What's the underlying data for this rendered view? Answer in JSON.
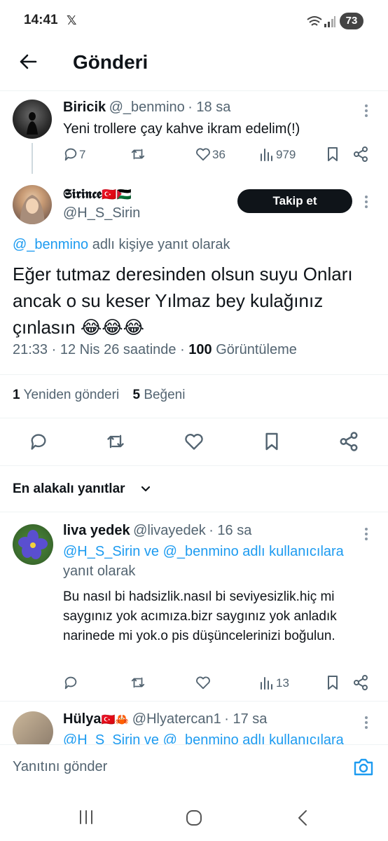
{
  "status_bar": {
    "time": "14:41",
    "app_glyph": "𝕏",
    "battery": "73"
  },
  "header": {
    "title": "Gönderi",
    "back_icon": "back-arrow-icon"
  },
  "parent_post": {
    "name": "Biricik",
    "handle": "@_benmino",
    "time": "· 18 sa",
    "text": "Yeni trollere çay kahve ikram edelim(!)",
    "replies": "7",
    "likes": "36",
    "views": "979"
  },
  "main_post": {
    "name": "𝕾𝖎𝖗𝖎𝖓𝖈𝖊",
    "name_flags": "🇹🇷🇵🇸",
    "handle": "@H_S_Sirin",
    "follow_label": "Takip et",
    "reply_to_handle": "@_benmino",
    "reply_to_suffix": " adlı kişiye yanıt olarak",
    "text": "Eğer tutmaz deresinden olsun suyu Onları ancak o su keser Yılmaz bey kulağınız çınlasın 😂😂😂",
    "time": "21:33",
    "date": "· 12 Nis 26 saatinde ·",
    "views_count": "100",
    "views_label": "Görüntüleme",
    "reposts_count": "1",
    "reposts_label": "Yeniden gönderi",
    "likes_count": "5",
    "likes_label": "Beğeni"
  },
  "replies_section": {
    "sort_label": "En alakalı yanıtlar"
  },
  "replies": [
    {
      "name": "liva yedek",
      "handle": "@livayedek",
      "time": "· 16 sa",
      "reply_to": "@H_S_Sirin ve @_benmino adlı kullanıcılara",
      "reply_suffix": "yanıt olarak",
      "text": "Bu nasıl bi hadsizlik.nasıl bi seviyesizlik.hiç mi saygınız yok acımıza.bizr saygınız yok anladık narinede mi yok.o pis düşüncelerinizi boğulun.",
      "views": "13"
    },
    {
      "name": "Hülya",
      "name_flags": "🇹🇷🦀",
      "handle": "@Hlyatercan1",
      "time": "· 17 sa",
      "reply_to": "@H_S_Sirin ve @_benmino adlı kullanıcılara"
    }
  ],
  "composer": {
    "placeholder": "Yanıtını gönder"
  },
  "colors": {
    "accent": "#1d9bf0",
    "text": "#0f1419",
    "muted": "#536471"
  }
}
